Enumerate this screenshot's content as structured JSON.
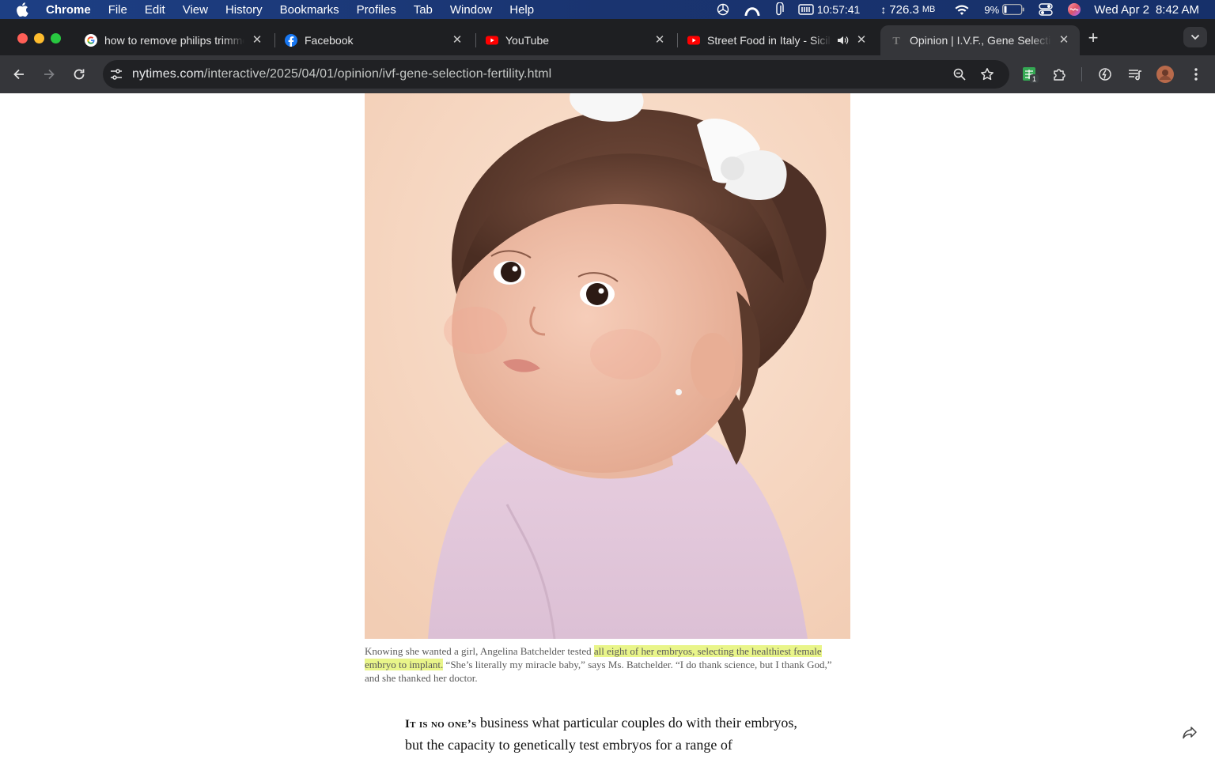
{
  "menubar": {
    "app": "Chrome",
    "items": [
      "File",
      "Edit",
      "View",
      "History",
      "Bookmarks",
      "Profiles",
      "Tab",
      "Window",
      "Help"
    ],
    "status": {
      "timer": "10:57:41",
      "memory": "726.3",
      "memory_unit": "MB",
      "battery": "9%",
      "date": "Wed Apr 2",
      "time": "8:42 AM"
    }
  },
  "tabs": [
    {
      "title": "how to remove philips trimme",
      "icon": "google-icon"
    },
    {
      "title": "Facebook",
      "icon": "facebook-icon"
    },
    {
      "title": "YouTube",
      "icon": "youtube-icon"
    },
    {
      "title": "Street Food in Italy - Sicily",
      "icon": "youtube-icon",
      "audio": true
    },
    {
      "title": "Opinion | I.V.F., Gene Selectio",
      "icon": "nyt-icon",
      "active": true
    }
  ],
  "toolbar": {
    "url_domain": "nytimes.com",
    "url_path": "/interactive/2025/04/01/opinion/ivf-gene-selection-fertility.html",
    "extension_badge": "1"
  },
  "article": {
    "caption_before": "Knowing she wanted a girl, Angelina Batchelder tested ",
    "caption_highlight": "all eight of her embryos, selecting the healthiest female embryo to implant.",
    "caption_after": " “She’s literally my miracle baby,” says Ms. Batchelder. “I do thank science, but I thank God,” and she thanked her doctor.",
    "lead_in": "It is no one’s",
    "body": " business what particular couples do with their embryos, but the capacity to genetically test embryos for a range of characteristics, fi..."
  },
  "colors": {
    "menubar": "#1a3470",
    "tabstrip": "#1e1f22",
    "toolbar": "#35363a",
    "highlight": "#e9f58a"
  }
}
